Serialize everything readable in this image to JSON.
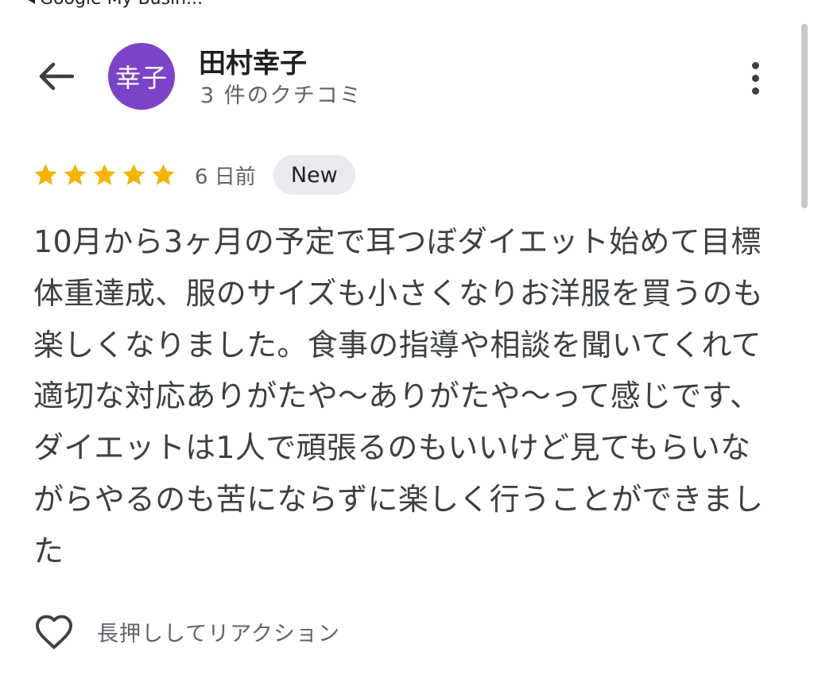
{
  "status_bar": {
    "back_label": "Google My Busin..."
  },
  "header": {
    "avatar_text": "幸子",
    "avatar_color": "#7b43c8",
    "user_name": "田村幸子",
    "review_count": "3 件のクチコミ",
    "back_icon": "arrow-left-icon",
    "more_icon": "more-vert-icon"
  },
  "review": {
    "rating": 5,
    "max_rating": 5,
    "star_color": "#f4b400",
    "date": "6 日前",
    "badge": "New",
    "text": "10月から3ヶ月の予定で耳つぼダイエット始めて目標体重達成、服のサイズも小さくなりお洋服を買うのも楽しくなりました。食事の指導や相談を聞いてくれて適切な対応ありがたや〜ありがたや〜って感じです、ダイエットは1人で頑張るのもいいけど見てもらいながらやるのも苦にならずに楽しく行うことができました"
  },
  "reaction": {
    "icon": "heart-outline-icon",
    "label": "長押ししてリアクション"
  }
}
